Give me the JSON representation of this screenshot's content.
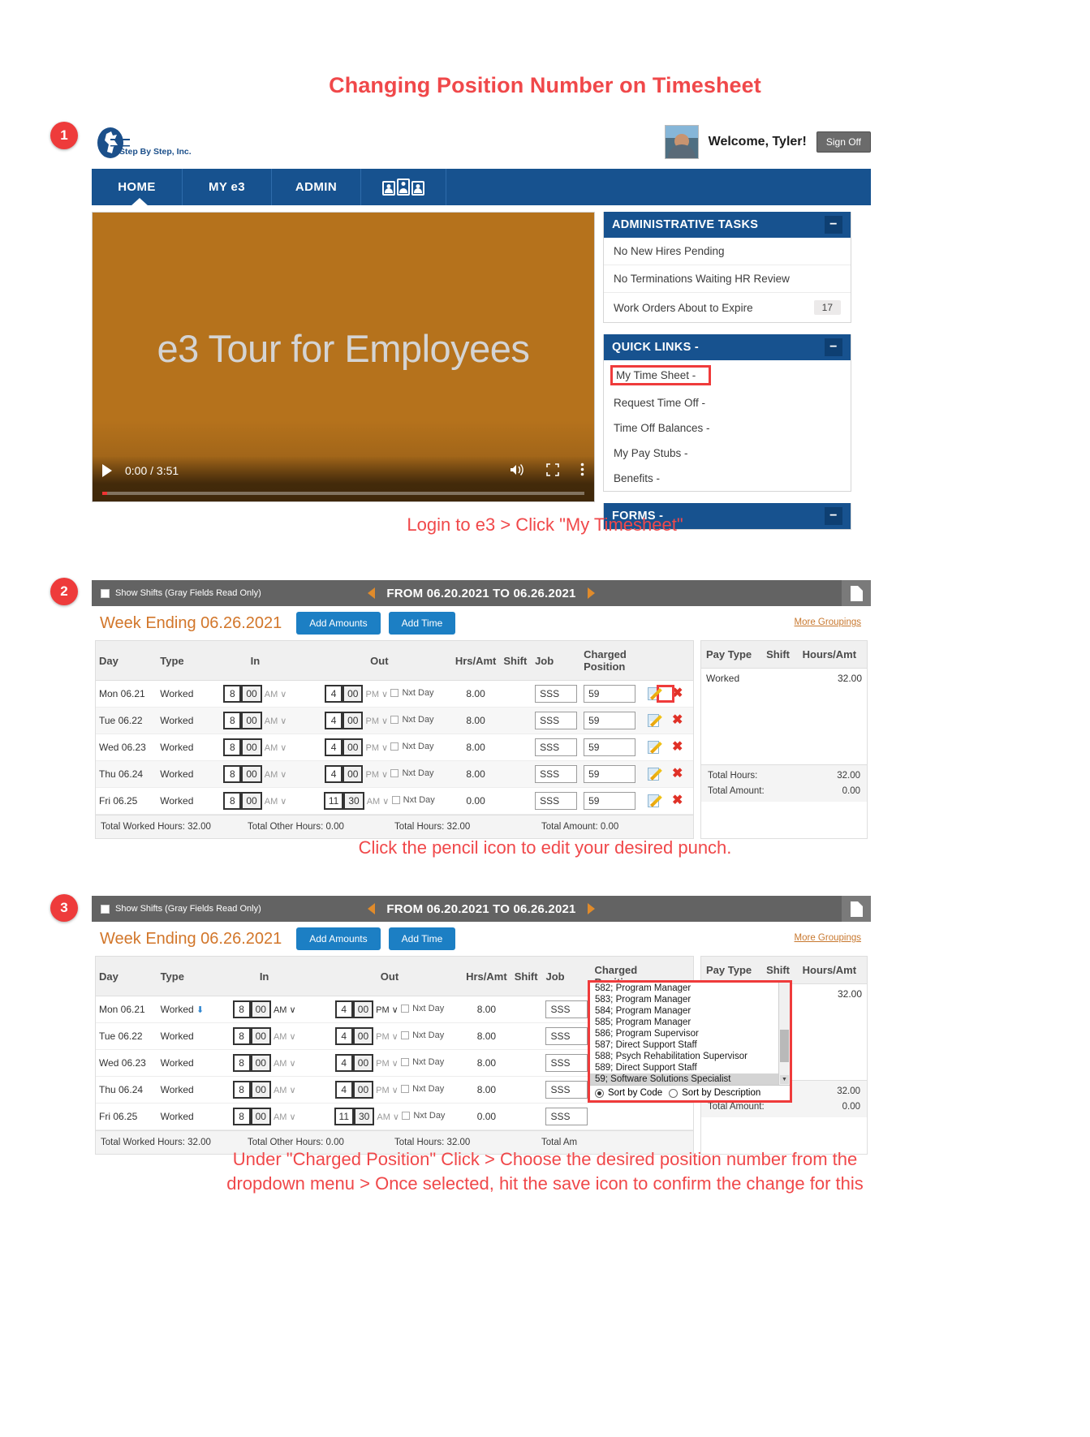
{
  "doc": {
    "title": "Changing Position Number on Timesheet"
  },
  "steps": {
    "one": "1",
    "two": "2",
    "three": "3"
  },
  "portal": {
    "logo_text": "Step By Step, Inc.",
    "welcome": "Welcome, Tyler!",
    "sign_off": "Sign Off",
    "nav": {
      "home": "HOME",
      "my_e3": "MY e3",
      "admin": "ADMIN",
      "people_icon": "people-icon"
    },
    "video": {
      "title": "e3 Tour for Employees",
      "time": "0:00 / 3:51",
      "play_icon": "play-icon",
      "volume_icon": "volume-icon",
      "fullscreen_icon": "fullscreen-icon",
      "more_icon": "more-vertical-icon"
    },
    "admin_tasks": {
      "header": "ADMINISTRATIVE TASKS",
      "collapse": "−",
      "rows": [
        {
          "label": "No New Hires Pending",
          "count": ""
        },
        {
          "label": "No Terminations Waiting HR Review",
          "count": ""
        },
        {
          "label": "Work Orders About to Expire",
          "count": "17"
        }
      ]
    },
    "quick_links": {
      "header": "QUICK LINKS -",
      "collapse": "−",
      "items": [
        "My Time Sheet -",
        "Request Time Off -",
        "Time Off Balances -",
        "My Pay Stubs -",
        "Benefits -"
      ]
    },
    "forms": {
      "header": "FORMS -",
      "collapse": "−"
    }
  },
  "captions": {
    "one": "Login to e3 > Click \"My Timesheet\"",
    "two": "Click the pencil icon to edit your desired punch.",
    "three_line1": "Under \"Charged Position\" Click > Choose the desired position number from the",
    "three_line2": "dropdown menu > Once selected, hit the save icon to confirm the change for this"
  },
  "timesheet": {
    "show_shifts": "Show Shifts (Gray Fields Read Only)",
    "range": "FROM 06.20.2021 TO 06.26.2021",
    "week_ending": "Week Ending 06.26.2021",
    "add_amounts": "Add Amounts",
    "add_time": "Add Time",
    "more_groupings": "More Groupings",
    "columns": [
      "Day",
      "Type",
      "In",
      "Out",
      "Hrs/Amt",
      "Shift",
      "Job",
      "Charged Position"
    ],
    "charged_position_l1": "Charged",
    "charged_position_l2": "Position",
    "nxt_day": "Nxt Day",
    "rows": [
      {
        "day": "Mon 06.21",
        "type": "Worked",
        "in_h": "8",
        "in_m": "00",
        "in_ampm": "AM",
        "out_h": "4",
        "out_m": "00",
        "out_ampm": "PM",
        "hrs": "8.00",
        "shift": "",
        "job": "SSS",
        "position": "59"
      },
      {
        "day": "Tue 06.22",
        "type": "Worked",
        "in_h": "8",
        "in_m": "00",
        "in_ampm": "AM",
        "out_h": "4",
        "out_m": "00",
        "out_ampm": "PM",
        "hrs": "8.00",
        "shift": "",
        "job": "SSS",
        "position": "59"
      },
      {
        "day": "Wed 06.23",
        "type": "Worked",
        "in_h": "8",
        "in_m": "00",
        "in_ampm": "AM",
        "out_h": "4",
        "out_m": "00",
        "out_ampm": "PM",
        "hrs": "8.00",
        "shift": "",
        "job": "SSS",
        "position": "59"
      },
      {
        "day": "Thu 06.24",
        "type": "Worked",
        "in_h": "8",
        "in_m": "00",
        "in_ampm": "AM",
        "out_h": "4",
        "out_m": "00",
        "out_ampm": "PM",
        "hrs": "8.00",
        "shift": "",
        "job": "SSS",
        "position": "59"
      },
      {
        "day": "Fri 06.25",
        "type": "Worked",
        "in_h": "8",
        "in_m": "00",
        "in_ampm": "AM",
        "out_h": "11",
        "out_m": "30",
        "out_ampm": "AM",
        "hrs": "0.00",
        "shift": "",
        "job": "SSS",
        "position": "59"
      }
    ],
    "totals": {
      "worked": "Total Worked Hours: 32.00",
      "other": "Total Other Hours: 0.00",
      "hours": "Total Hours: 32.00",
      "amount": "Total Amount: 0.00",
      "amount_short": "Total Am"
    },
    "side": {
      "columns": [
        "Pay Type",
        "Shift",
        "Hours/Amt"
      ],
      "row_label": "Worked",
      "row_value": "32.00",
      "total_hours_label": "Total Hours:",
      "total_hours_value": "32.00",
      "total_amount_label": "Total Amount:",
      "total_amount_value": "0.00"
    },
    "icons": {
      "save": "save-icon",
      "pencil": "pencil-icon",
      "delete": "delete-icon",
      "cancel": "cancel-icon",
      "doc": "document-icon",
      "prev": "prev-arrow-icon",
      "next": "next-arrow-icon"
    }
  },
  "dropdown": {
    "options": [
      "582; Program Manager",
      "583; Program Manager",
      "584; Program Manager",
      "585; Program Manager",
      "586; Program Supervisor",
      "587; Direct Support Staff",
      "588; Psych Rehabilitation Supervisor",
      "589; Direct Support Staff",
      "59; Software Solutions Specialist"
    ],
    "selected": "59; Software Solutions Specialist",
    "sort_by_code": "Sort by Code",
    "sort_by_description": "Sort by Description",
    "scroll_down_icon": "▼"
  },
  "colors": {
    "accent_red": "#f0484a",
    "brand_blue": "#17528f",
    "orange": "#d2762a",
    "button_blue": "#1c7fc4",
    "video_bg": "#b5721c"
  }
}
